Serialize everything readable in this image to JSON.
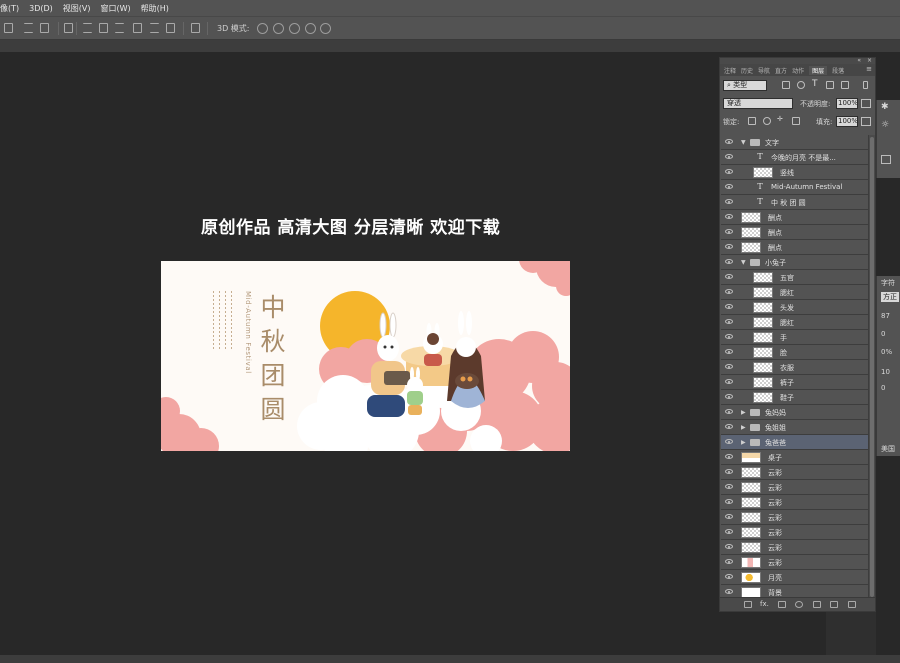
{
  "menubar": {
    "items": [
      "像(T)",
      "3D(D)",
      "视图(V)",
      "窗口(W)",
      "帮助(H)"
    ]
  },
  "options_bar": {
    "mode_label": "3D 模式:"
  },
  "artwork": {
    "headline": "原创作品 高清大图 分层清晰 欢迎下载",
    "title_chars": [
      "中",
      "秋",
      "团",
      "圆"
    ],
    "subtitle_en": "Mid-Autumn Festival",
    "palette": {
      "moon": "#f5b52b",
      "cloud_pink": "#f2a6a2",
      "cloud_white": "#ffffff",
      "title_gold": "#a98c69"
    }
  },
  "layers_panel": {
    "tabs": [
      "注释",
      "历史",
      "导航",
      "直方",
      "动作",
      "图层",
      "段落"
    ],
    "active_tab": "图层",
    "filter_kind": "类型",
    "blend_mode": "穿透",
    "opacity_label": "不透明度:",
    "opacity_value": "100%",
    "lock_label": "锁定:",
    "fill_label": "填充:",
    "fill_value": "100%",
    "layers": [
      {
        "name": "文字",
        "kind": "group",
        "level": 0,
        "open": true
      },
      {
        "name": "今晚的月亮 不是最...",
        "kind": "text",
        "level": 1
      },
      {
        "name": "竖线",
        "kind": "pixel",
        "level": 1
      },
      {
        "name": "Mid-Autumn Festival",
        "kind": "text",
        "level": 1
      },
      {
        "name": "中 秋 团 圆",
        "kind": "text",
        "level": 1
      },
      {
        "name": "酬点",
        "kind": "pixel",
        "level": 0
      },
      {
        "name": "酬点",
        "kind": "pixel",
        "level": 0
      },
      {
        "name": "酬点",
        "kind": "pixel",
        "level": 0
      },
      {
        "name": "小兔子",
        "kind": "group",
        "level": 0,
        "open": true
      },
      {
        "name": "五官",
        "kind": "pixel",
        "level": 1
      },
      {
        "name": "腮红",
        "kind": "pixel",
        "level": 1
      },
      {
        "name": "头发",
        "kind": "pixel",
        "level": 1
      },
      {
        "name": "腮红",
        "kind": "pixel",
        "level": 1
      },
      {
        "name": "手",
        "kind": "pixel",
        "level": 1
      },
      {
        "name": "脸",
        "kind": "pixel",
        "level": 1
      },
      {
        "name": "衣服",
        "kind": "pixel",
        "level": 1
      },
      {
        "name": "裤子",
        "kind": "pixel",
        "level": 1
      },
      {
        "name": "鞋子",
        "kind": "pixel",
        "level": 1
      },
      {
        "name": "兔妈妈",
        "kind": "group",
        "level": 0,
        "open": false
      },
      {
        "name": "兔姐姐",
        "kind": "group",
        "level": 0,
        "open": false
      },
      {
        "name": "兔爸爸",
        "kind": "group",
        "level": 0,
        "open": false,
        "selected": true
      },
      {
        "name": "桌子",
        "kind": "pixel",
        "level": 0,
        "thumb": "table"
      },
      {
        "name": "云彩",
        "kind": "pixel",
        "level": 0
      },
      {
        "name": "云彩",
        "kind": "pixel",
        "level": 0
      },
      {
        "name": "云彩",
        "kind": "pixel",
        "level": 0
      },
      {
        "name": "云彩",
        "kind": "pixel",
        "level": 0
      },
      {
        "name": "云彩",
        "kind": "pixel",
        "level": 0
      },
      {
        "name": "云彩",
        "kind": "pixel",
        "level": 0
      },
      {
        "name": "云彩",
        "kind": "pixel",
        "level": 0,
        "thumb": "art2"
      },
      {
        "name": "月亮",
        "kind": "pixel",
        "level": 0,
        "thumb": "moon"
      },
      {
        "name": "背景",
        "kind": "pixel",
        "level": 0,
        "thumb": "white"
      }
    ]
  },
  "right_edge": {
    "labels": [
      "字符",
      "方正",
      "87",
      "0",
      "0%",
      "10",
      "0",
      "美国"
    ]
  }
}
